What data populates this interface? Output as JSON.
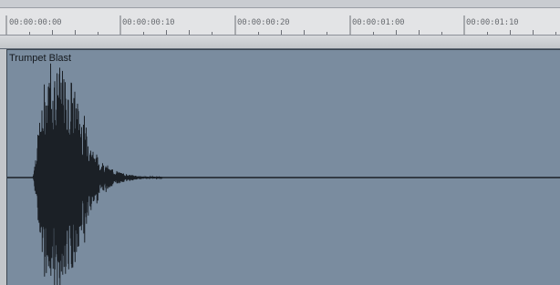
{
  "ruler": {
    "labels": [
      "00:00:00:00",
      "00:00:00:10",
      "00:00:00:20",
      "00:00:01:00",
      "00:00:01:10"
    ]
  },
  "clip": {
    "title": "Trumpet Blast"
  },
  "colors": {
    "ruler_bg": "#e3e4e6",
    "clip_bg": "#7a8c9f",
    "waveform": "#1b2026"
  }
}
